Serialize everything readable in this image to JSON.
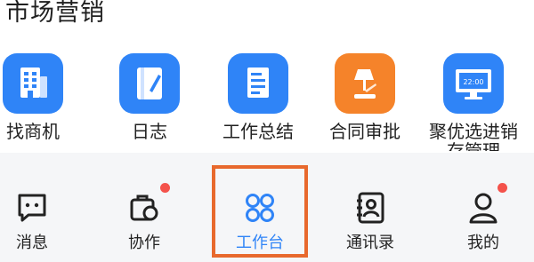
{
  "section": {
    "title": "市场营销"
  },
  "apps": [
    {
      "label": "找商机",
      "icon": "building-icon",
      "color": "#2f84f7"
    },
    {
      "label": "日志",
      "icon": "journal-icon",
      "color": "#2f84f7"
    },
    {
      "label": "工作总结",
      "icon": "document-icon",
      "color": "#2f84f7"
    },
    {
      "label": "合同审批",
      "icon": "lamp-icon",
      "color": "#f5832a"
    },
    {
      "label": "聚优选进销",
      "label2": "存管理",
      "icon": "monitor-icon",
      "color": "#2f84f7",
      "screen_text": "22:00"
    }
  ],
  "tabs": [
    {
      "label": "消息",
      "icon": "message-icon",
      "badge": false
    },
    {
      "label": "协作",
      "icon": "collaborate-icon",
      "badge": true
    },
    {
      "label": "工作台",
      "icon": "workbench-icon",
      "badge": false,
      "active": true
    },
    {
      "label": "通讯录",
      "icon": "contacts-icon",
      "badge": false
    },
    {
      "label": "我的",
      "icon": "profile-icon",
      "badge": true
    }
  ],
  "colors": {
    "accent": "#2f84f7",
    "highlight": "#e8692d",
    "badge": "#f4524b"
  }
}
